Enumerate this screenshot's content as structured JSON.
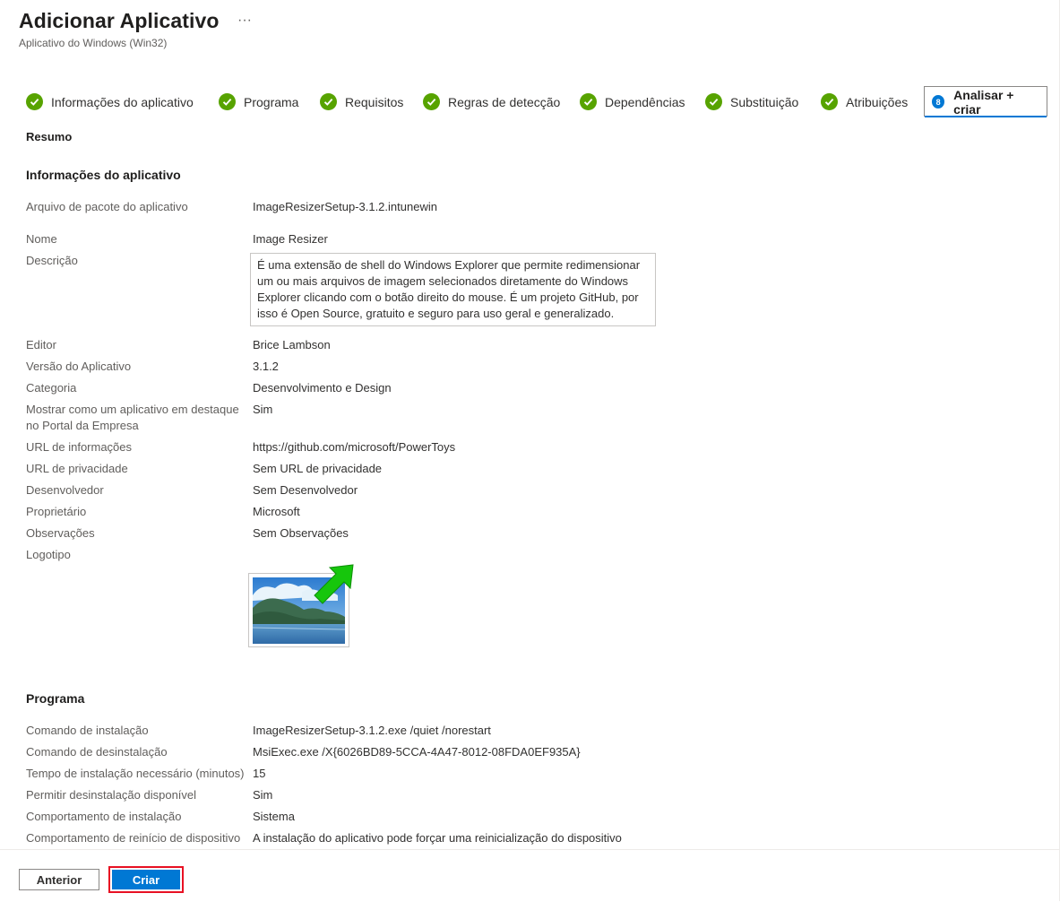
{
  "header": {
    "title": "Adicionar Aplicativo",
    "more": "···",
    "subtitle": "Aplicativo do Windows (Win32)"
  },
  "steps": [
    {
      "label": "Informações do aplicativo"
    },
    {
      "label": "Programa"
    },
    {
      "label": "Requisitos"
    },
    {
      "label": "Regras de detecção"
    },
    {
      "label": "Dependências"
    },
    {
      "label": "Substituição"
    },
    {
      "label": "Atribuições"
    },
    {
      "label": "Analisar + criar",
      "number": "8"
    }
  ],
  "summary": {
    "heading": "Resumo",
    "app_info": {
      "title": "Informações do aplicativo",
      "rows": [
        {
          "key": "Arquivo de pacote do aplicativo",
          "value": "ImageResizerSetup-3.1.2.intunewin"
        },
        {
          "key": "Nome",
          "value": "Image Resizer"
        },
        {
          "key": "Descrição",
          "value": "É uma extensão de shell do Windows Explorer que permite redimensionar um ou mais arquivos de imagem selecionados diretamente do Windows Explorer clicando com o botão direito do mouse. É um projeto GitHub, por isso é Open Source, gratuito e seguro para uso geral e generalizado."
        },
        {
          "key": "Editor",
          "value": "Brice Lambson"
        },
        {
          "key": "Versão do Aplicativo",
          "value": "3.1.2"
        },
        {
          "key": "Categoria",
          "value": "Desenvolvimento e Design"
        },
        {
          "key": "Mostrar como um aplicativo em destaque no Portal da Empresa",
          "value": "Sim"
        },
        {
          "key": "URL de informações",
          "value": "https://github.com/microsoft/PowerToys"
        },
        {
          "key": "URL de privacidade",
          "value": "Sem URL de privacidade"
        },
        {
          "key": "Desenvolvedor",
          "value": "Sem Desenvolvedor"
        },
        {
          "key": "Proprietário",
          "value": "Microsoft"
        },
        {
          "key": "Observações",
          "value": "Sem Observações"
        },
        {
          "key": "Logotipo",
          "value": ""
        }
      ]
    },
    "program": {
      "title": "Programa",
      "rows": [
        {
          "key": "Comando de instalação",
          "value": "ImageResizerSetup-3.1.2.exe /quiet /norestart"
        },
        {
          "key": "Comando de desinstalação",
          "value": "MsiExec.exe /X{6026BD89-5CCA-4A47-8012-08FDA0EF935A}"
        },
        {
          "key": "Tempo de instalação necessário (minutos)",
          "value": "15"
        },
        {
          "key": "Permitir desinstalação disponível",
          "value": "Sim"
        },
        {
          "key": "Comportamento de instalação",
          "value": "Sistema"
        },
        {
          "key": "Comportamento de reinício de dispositivo",
          "value": "A instalação do aplicativo pode forçar uma reinicialização do dispositivo"
        }
      ]
    }
  },
  "footer": {
    "prev_label": "Anterior",
    "create_label": "Criar"
  },
  "colors": {
    "accent": "#0078d4",
    "success": "#57a300",
    "highlight": "#e81123"
  }
}
